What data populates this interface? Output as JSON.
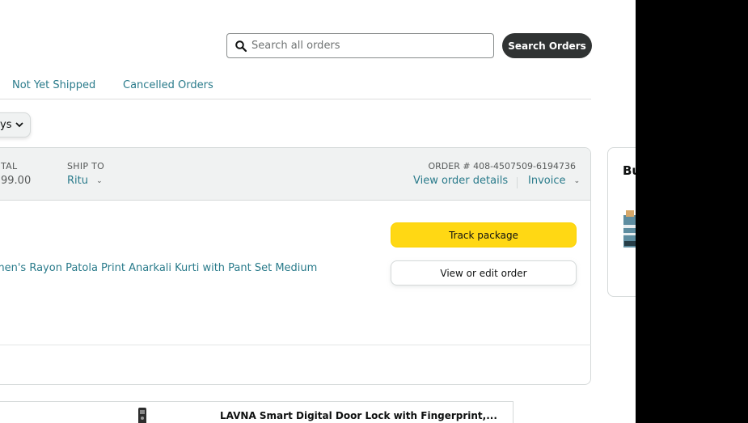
{
  "search": {
    "placeholder": "Search all orders",
    "value": "",
    "button_label": "Search Orders"
  },
  "tabs": [
    {
      "label": "Not Yet Shipped"
    },
    {
      "label": "Cancelled Orders"
    }
  ],
  "filter": {
    "label": "ys"
  },
  "order": {
    "total_label": "TAL",
    "total_value": "99.00",
    "ship_to_label": "SHIP TO",
    "ship_to_value": "Ritu",
    "order_number": "ORDER # 408-4507509-6194736",
    "view_details_link": "View order details",
    "invoice_link": "Invoice",
    "product_title": "omen's Rayon Patola Print Anarkali Kurti with Pant Set Medium",
    "track_button": "Track package",
    "edit_button": "View or edit order"
  },
  "side_panel": {
    "title": "Bu"
  },
  "recommendation": {
    "title": "LAVNA Smart Digital Door Lock with Fingerprint,..."
  },
  "colors": {
    "link": "#2a7b8b",
    "primary_button": "#ffd814",
    "dark_button": "#303333",
    "header_bg": "#f0f2f2"
  }
}
